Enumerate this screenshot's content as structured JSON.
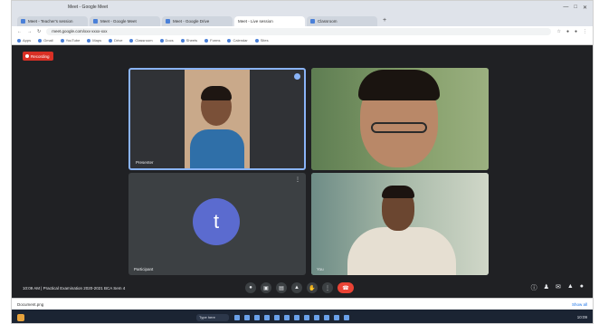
{
  "window": {
    "title": "Meet - Google Meet"
  },
  "tabs": [
    {
      "label": "Meet - Teacher's session",
      "active": false
    },
    {
      "label": "Meet - Google Meet",
      "active": false
    },
    {
      "label": "Meet - Google Drive",
      "active": false
    },
    {
      "label": "Meet - Live session",
      "active": true
    },
    {
      "label": "Classroom",
      "active": false
    }
  ],
  "addressbar": {
    "url": "meet.google.com/xxx-xxxx-xxx"
  },
  "bookmarks": [
    "Apps",
    "Gmail",
    "YouTube",
    "Maps",
    "Drive",
    "Classroom",
    "Docs",
    "Sheets",
    "Forms",
    "Calendar",
    "Sites"
  ],
  "meet": {
    "recording_label": "Recording",
    "tiles": [
      {
        "name": "Presenter"
      },
      {
        "name": ""
      },
      {
        "name": "Participant",
        "avatar_letter": "t"
      },
      {
        "name": "You"
      }
    ],
    "meeting_info": "10:09 AM  |  Practical Examination 2020-2021 BCA Sem 4",
    "controls": [
      "mic-icon",
      "camera-icon",
      "captions-icon",
      "present-icon",
      "raise-hand-icon",
      "more-icon",
      "end-call-icon"
    ],
    "side_controls": [
      "info-icon",
      "people-icon",
      "chat-icon",
      "activities-icon",
      "lock-icon"
    ]
  },
  "download": {
    "file": "Document.png",
    "show_all": "Show all"
  },
  "taskbar": {
    "search": "Type here",
    "time": "10:09",
    "date": ""
  },
  "colors": {
    "accent": "#8ab4f8",
    "end_call": "#ea4335",
    "recording": "#d93025",
    "avatar": "#5b6bcf"
  }
}
